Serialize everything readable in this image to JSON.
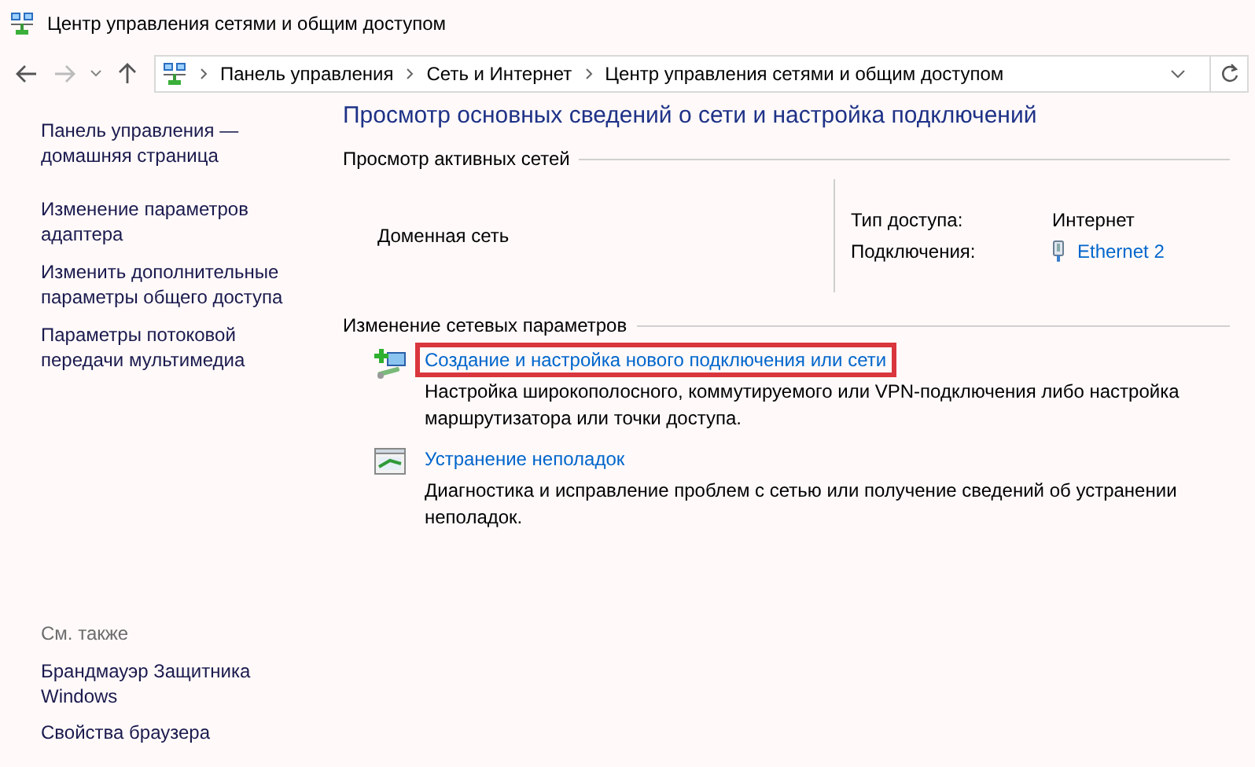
{
  "window": {
    "title": "Центр управления сетями и общим доступом"
  },
  "address_bar": {
    "breadcrumbs": [
      "Панель управления",
      "Сеть и Интернет",
      "Центр управления сетями и общим доступом"
    ]
  },
  "sidebar": {
    "items": [
      {
        "label": "Панель управления — домашняя страница"
      },
      {
        "label": "Изменение параметров адаптера"
      },
      {
        "label": "Изменить дополнительные параметры общего доступа"
      },
      {
        "label": "Параметры потоковой передачи мультимедиа"
      }
    ],
    "see_also": {
      "heading": "См. также",
      "items": [
        {
          "label": "Брандмауэр Защитника Windows"
        },
        {
          "label": "Свойства браузера"
        }
      ]
    }
  },
  "main": {
    "title": "Просмотр основных сведений о сети и настройка подключений",
    "active_networks": {
      "heading": "Просмотр активных сетей",
      "network_name": "Доменная сеть",
      "properties": [
        {
          "label": "Тип доступа:",
          "value": "Интернет",
          "kind": "text"
        },
        {
          "label": "Подключения:",
          "value": "Ethernet 2",
          "kind": "link"
        }
      ]
    },
    "change_settings": {
      "heading": "Изменение сетевых параметров",
      "tasks": [
        {
          "kind": "new-connection",
          "link": "Создание и настройка нового подключения или сети",
          "description": "Настройка широкополосного, коммутируемого или VPN-подключения либо настройка маршрутизатора или точки доступа.",
          "highlighted": true
        },
        {
          "kind": "troubleshoot",
          "link": "Устранение неполадок",
          "description": "Диагностика и исправление проблем с сетью или получение сведений об устранении неполадок.",
          "highlighted": false
        }
      ]
    }
  }
}
